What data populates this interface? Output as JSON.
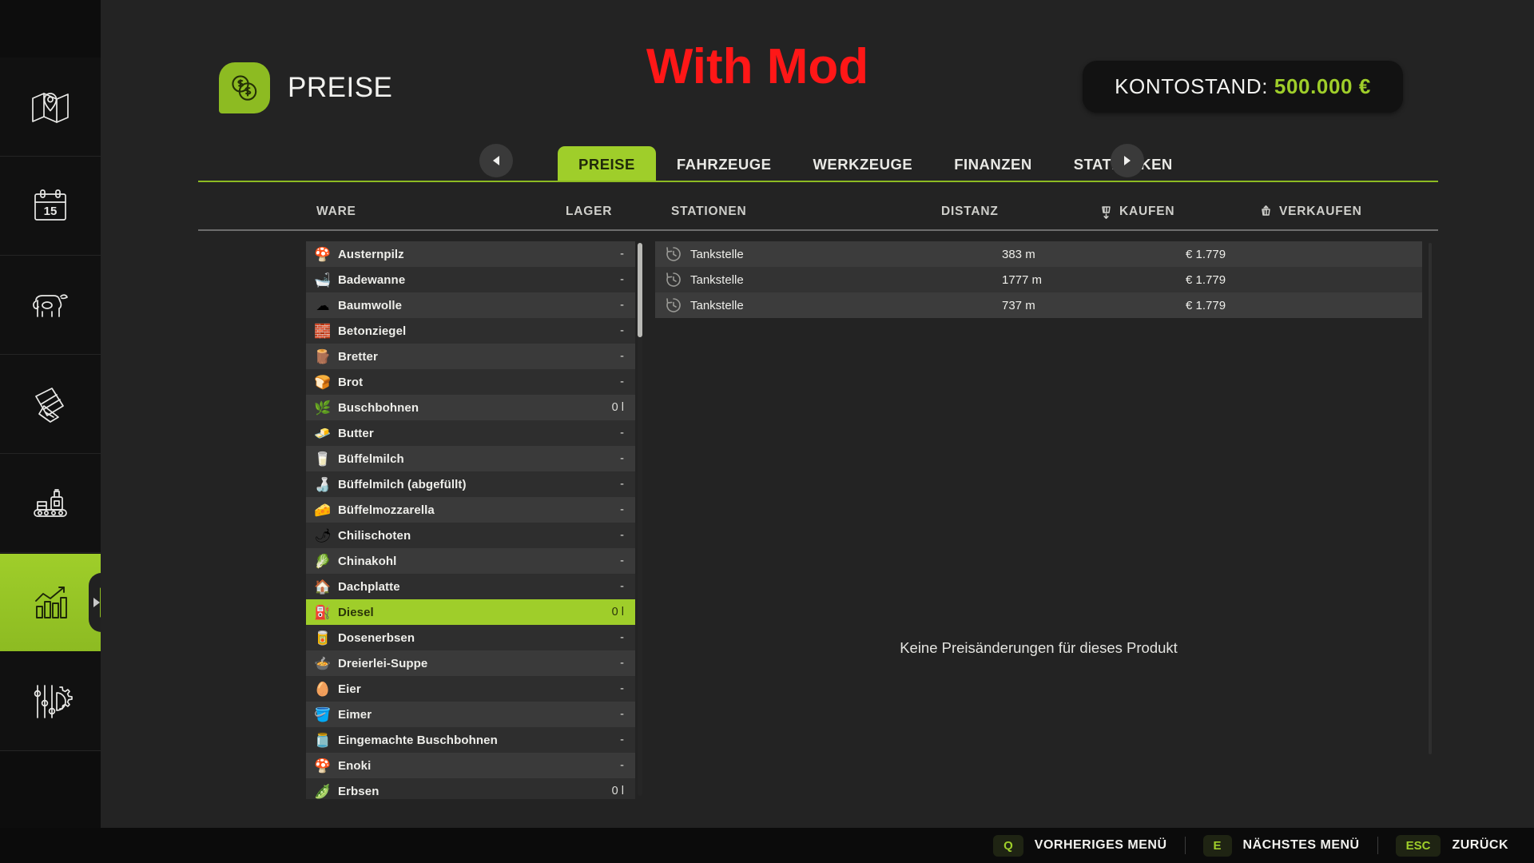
{
  "sidebar": {
    "items": [
      {
        "name": "map-icon",
        "label": "Karte"
      },
      {
        "name": "calendar-icon",
        "label": "Kalender",
        "day": "15"
      },
      {
        "name": "cow-icon",
        "label": "Tiere"
      },
      {
        "name": "contracts-icon",
        "label": "Vertraege"
      },
      {
        "name": "production-icon",
        "label": "Produktion"
      },
      {
        "name": "statistics-icon",
        "label": "Statistiken",
        "active": true
      },
      {
        "name": "settings-icon",
        "label": "Einstellungen"
      }
    ]
  },
  "header": {
    "title": "PREISE",
    "icon": "coins-icon",
    "mod_banner": "With Mod",
    "balance_label": "KONTOSTAND:",
    "balance_value": "500.000 €"
  },
  "tabs": {
    "prev_button": "prev-tab-button",
    "next_button": "next-tab-button",
    "items": [
      {
        "label": "PREISE",
        "active": true
      },
      {
        "label": "FAHRZEUGE",
        "active": false
      },
      {
        "label": "WERKZEUGE",
        "active": false
      },
      {
        "label": "FINANZEN",
        "active": false
      },
      {
        "label": "STATISTIKEN",
        "active": false
      }
    ]
  },
  "columns": {
    "ware": "WARE",
    "lager": "LAGER",
    "stationen": "STATIONEN",
    "distanz": "DISTANZ",
    "kaufen": "KAUFEN",
    "verkaufen": "VERKAUFEN"
  },
  "goods": [
    {
      "name": "Austernpilz",
      "qty": "-",
      "glyph": "🍄",
      "selected": false
    },
    {
      "name": "Badewanne",
      "qty": "-",
      "glyph": "🛁",
      "selected": false
    },
    {
      "name": "Baumwolle",
      "qty": "-",
      "glyph": "☁",
      "selected": false
    },
    {
      "name": "Betonziegel",
      "qty": "-",
      "glyph": "🧱",
      "selected": false
    },
    {
      "name": "Bretter",
      "qty": "-",
      "glyph": "🪵",
      "selected": false
    },
    {
      "name": "Brot",
      "qty": "-",
      "glyph": "🍞",
      "selected": false
    },
    {
      "name": "Buschbohnen",
      "qty": "0 l",
      "glyph": "🌿",
      "selected": false
    },
    {
      "name": "Butter",
      "qty": "-",
      "glyph": "🧈",
      "selected": false
    },
    {
      "name": "Büffelmilch",
      "qty": "-",
      "glyph": "🥛",
      "selected": false
    },
    {
      "name": "Büffelmilch (abgefüllt)",
      "qty": "-",
      "glyph": "🍶",
      "selected": false
    },
    {
      "name": "Büffelmozzarella",
      "qty": "-",
      "glyph": "🧀",
      "selected": false
    },
    {
      "name": "Chilischoten",
      "qty": "-",
      "glyph": "🌶",
      "selected": false
    },
    {
      "name": "Chinakohl",
      "qty": "-",
      "glyph": "🥬",
      "selected": false
    },
    {
      "name": "Dachplatte",
      "qty": "-",
      "glyph": "🏠",
      "selected": false
    },
    {
      "name": "Diesel",
      "qty": "0 l",
      "glyph": "⛽",
      "selected": true
    },
    {
      "name": "Dosenerbsen",
      "qty": "-",
      "glyph": "🥫",
      "selected": false
    },
    {
      "name": "Dreierlei-Suppe",
      "qty": "-",
      "glyph": "🍲",
      "selected": false
    },
    {
      "name": "Eier",
      "qty": "-",
      "glyph": "🥚",
      "selected": false
    },
    {
      "name": "Eimer",
      "qty": "-",
      "glyph": "🪣",
      "selected": false
    },
    {
      "name": "Eingemachte Buschbohnen",
      "qty": "-",
      "glyph": "🫙",
      "selected": false
    },
    {
      "name": "Enoki",
      "qty": "-",
      "glyph": "🍄",
      "selected": false
    },
    {
      "name": "Erbsen",
      "qty": "0 l",
      "glyph": "🫛",
      "selected": false
    }
  ],
  "stations": [
    {
      "name": "Tankstelle",
      "distance": "383 m",
      "buy_price": "€ 1.779"
    },
    {
      "name": "Tankstelle",
      "distance": "1777 m",
      "buy_price": "€ 1.779"
    },
    {
      "name": "Tankstelle",
      "distance": "737 m",
      "buy_price": "€ 1.779"
    }
  ],
  "empty_message": "Keine Preisänderungen für dieses Produkt",
  "footer": {
    "hints": [
      {
        "key": "Q",
        "label": "VORHERIGES MENÜ"
      },
      {
        "key": "E",
        "label": "NÄCHSTES MENÜ"
      },
      {
        "key": "ESC",
        "label": "ZURÜCK"
      }
    ]
  },
  "colors": {
    "accent": "#9fce2a",
    "mod_banner": "#ff1717",
    "panel": "#232323",
    "sidebar": "#0d0d0d"
  }
}
